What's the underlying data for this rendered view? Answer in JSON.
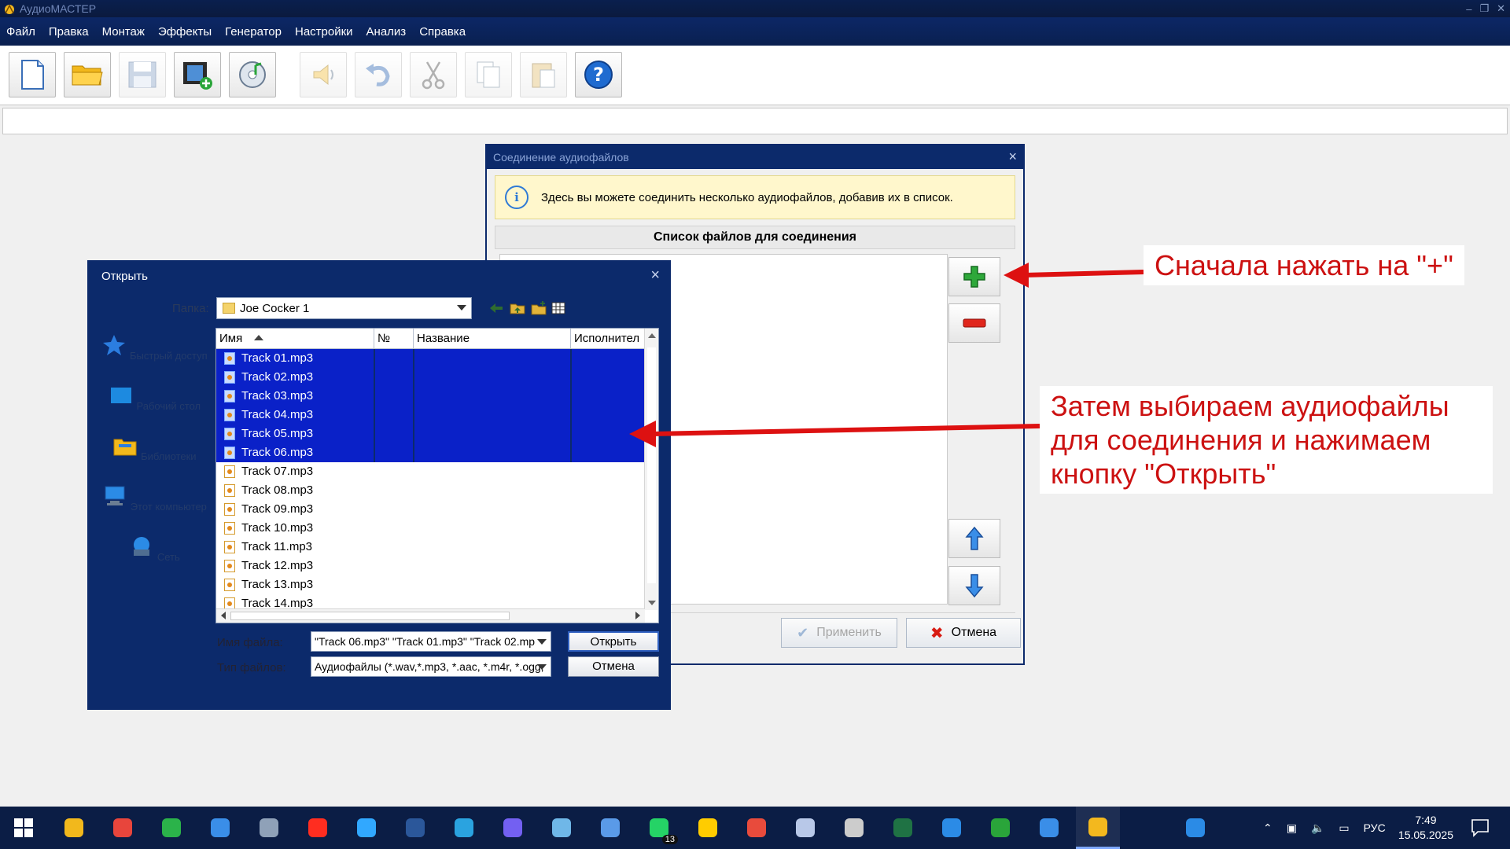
{
  "app": {
    "title": "АудиоМАСТЕР",
    "menu": [
      "Файл",
      "Правка",
      "Монтаж",
      "Эффекты",
      "Генератор",
      "Настройки",
      "Анализ",
      "Справка"
    ]
  },
  "toolbar": {
    "buttons": [
      {
        "icon": "new-file-icon",
        "enabled": true
      },
      {
        "icon": "open-folder-icon",
        "enabled": true
      },
      {
        "icon": "save-icon",
        "enabled": false
      },
      {
        "icon": "add-video-icon",
        "enabled": true
      },
      {
        "icon": "cd-music-icon",
        "enabled": true
      },
      {
        "icon": "speaker-icon",
        "enabled": false
      },
      {
        "icon": "undo-icon",
        "enabled": false
      },
      {
        "icon": "cut-icon",
        "enabled": false
      },
      {
        "icon": "copy-icon",
        "enabled": false
      },
      {
        "icon": "paste-icon",
        "enabled": false
      },
      {
        "icon": "help-icon",
        "enabled": true
      }
    ]
  },
  "join_dialog": {
    "title": "Соединение аудиофайлов",
    "info": "Здесь вы можете соединить несколько аудиофайлов, добавив их в список.",
    "list_header": "Список файлов для соединения",
    "apply_label": "Применить",
    "cancel_label": "Отмена"
  },
  "open_dialog": {
    "title": "Открыть",
    "folder_label": "Папка:",
    "folder_value": "Joe Cocker 1",
    "places": [
      "Быстрый доступ",
      "Рабочий стол",
      "Библиотеки",
      "Этот компьютер",
      "Сеть"
    ],
    "columns": [
      "Имя",
      "№",
      "Название",
      "Исполнител"
    ],
    "files": [
      {
        "name": "Track 01.mp3",
        "selected": true
      },
      {
        "name": "Track 02.mp3",
        "selected": true
      },
      {
        "name": "Track 03.mp3",
        "selected": true
      },
      {
        "name": "Track 04.mp3",
        "selected": true
      },
      {
        "name": "Track 05.mp3",
        "selected": true
      },
      {
        "name": "Track 06.mp3",
        "selected": true
      },
      {
        "name": "Track 07.mp3",
        "selected": false
      },
      {
        "name": "Track 08.mp3",
        "selected": false
      },
      {
        "name": "Track 09.mp3",
        "selected": false
      },
      {
        "name": "Track 10.mp3",
        "selected": false
      },
      {
        "name": "Track 11.mp3",
        "selected": false
      },
      {
        "name": "Track 12.mp3",
        "selected": false
      },
      {
        "name": "Track 13.mp3",
        "selected": false
      },
      {
        "name": "Track 14.mp3",
        "selected": false
      }
    ],
    "filename_label": "Имя файла:",
    "filename_value": "\"Track 06.mp3\" \"Track 01.mp3\" \"Track 02.mp",
    "filetype_label": "Тип файлов:",
    "filetype_value": "Аудиофайлы (*.wav,*.mp3, *.aac, *.m4r, *.ogg,",
    "open_label": "Открыть",
    "cancel_label": "Отмена"
  },
  "annotations": {
    "step1": "Сначала нажать на \"+\"",
    "step2_line1": "Затем выбираем аудиофайлы",
    "step2_line2": "для соединения и нажимаем",
    "step2_line3": "кнопку \"Открыть\""
  },
  "taskbar": {
    "apps": [
      "start-icon",
      "file-explorer-icon",
      "chrome-icon",
      "green-c-app-icon",
      "monitor-app-icon",
      "calculator-icon",
      "yandex-icon",
      "photoshop-icon",
      "word-icon",
      "telegram-icon",
      "viber-icon",
      "notebook-app-icon",
      "v-app-icon",
      "whatsapp-icon",
      "emoji-app-icon",
      "colorwheel-app-icon",
      "pen-app-icon",
      "film-reel-icon",
      "excel-icon",
      "c-circle-icon",
      "u-circle-icon",
      "display-app-icon",
      "audiomaster-icon",
      "onedrive-icon"
    ],
    "whatsapp_badge": "13",
    "language": "РУС",
    "time": "7:49",
    "date": "15.05.2025"
  },
  "colors": {
    "menubar": "#0c2766",
    "selection": "#0a21c8",
    "annotation": "#cc1111",
    "taskbar": "#0b1d45"
  }
}
